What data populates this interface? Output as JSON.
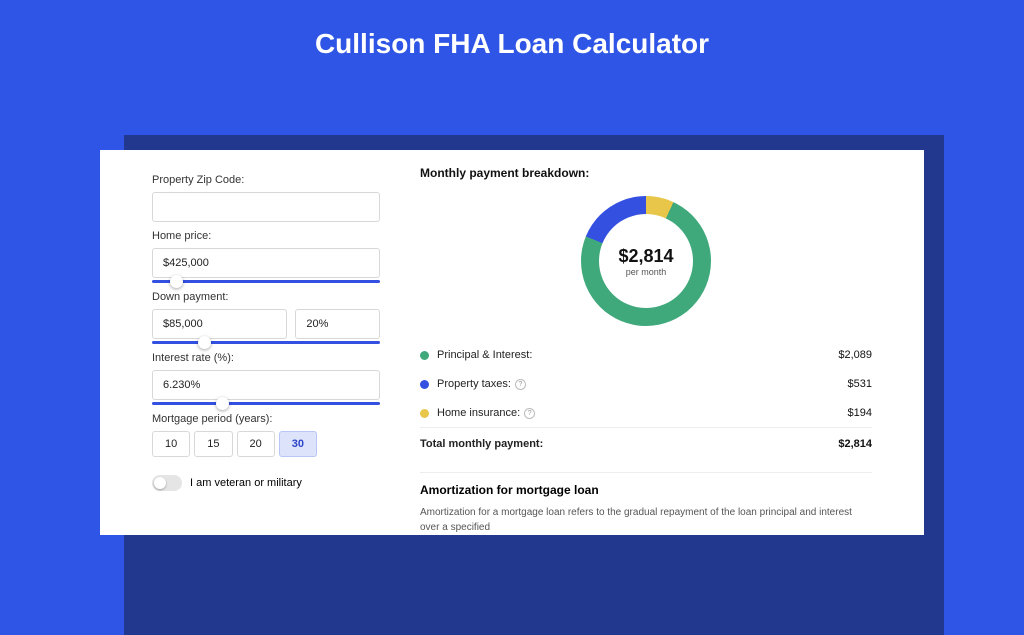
{
  "page": {
    "title": "Cullison FHA Loan Calculator"
  },
  "form": {
    "zip_label": "Property Zip Code:",
    "zip_value": "",
    "home_price_label": "Home price:",
    "home_price_value": "$425,000",
    "down_payment_label": "Down payment:",
    "down_payment_value": "$85,000",
    "down_payment_pct": "20%",
    "interest_label": "Interest rate (%):",
    "interest_value": "6.230%",
    "period_label": "Mortgage period (years):",
    "periods": [
      "10",
      "15",
      "20",
      "30"
    ],
    "period_selected": "30",
    "veteran_label": "I am veteran or military",
    "slider_positions": {
      "home_price_pct": 8,
      "down_payment_pct": 20,
      "interest_pct": 28
    }
  },
  "breakdown": {
    "title": "Monthly payment breakdown:",
    "center_value": "$2,814",
    "center_sub": "per month",
    "items": [
      {
        "color": "g",
        "label": "Principal & Interest:",
        "amount": "$2,089",
        "info": false
      },
      {
        "color": "b",
        "label": "Property taxes:",
        "amount": "$531",
        "info": true
      },
      {
        "color": "y",
        "label": "Home insurance:",
        "amount": "$194",
        "info": true
      }
    ],
    "total_label": "Total monthly payment:",
    "total_amount": "$2,814"
  },
  "chart_data": {
    "type": "pie",
    "title": "Monthly payment breakdown",
    "series": [
      {
        "name": "Principal & Interest",
        "value": 2089,
        "color": "#3fa97b"
      },
      {
        "name": "Property taxes",
        "value": 531,
        "color": "#3350e0"
      },
      {
        "name": "Home insurance",
        "value": 194,
        "color": "#e8c64a"
      }
    ],
    "total": 2814
  },
  "amort": {
    "title": "Amortization for mortgage loan",
    "body": "Amortization for a mortgage loan refers to the gradual repayment of the loan principal and interest over a specified"
  }
}
